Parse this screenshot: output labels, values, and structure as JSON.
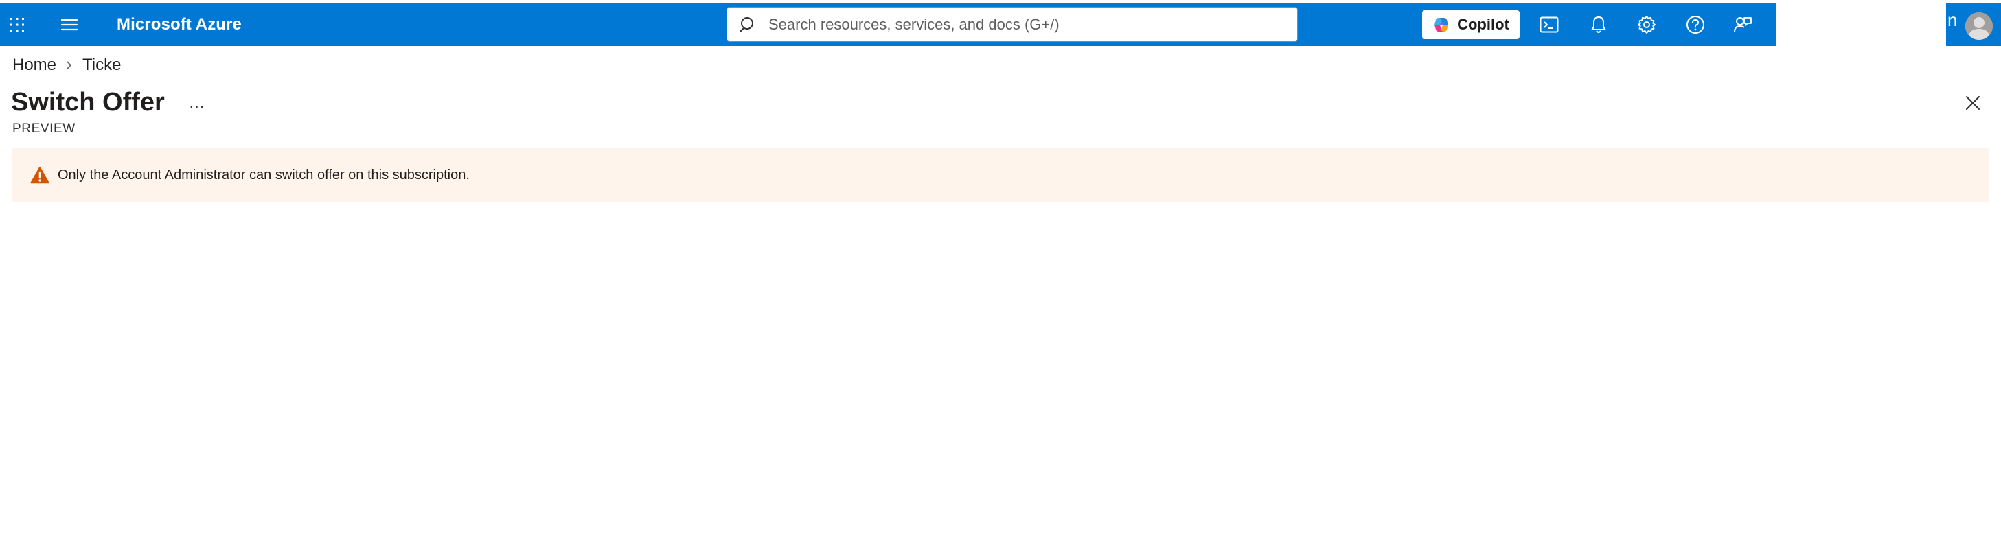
{
  "topbar": {
    "brand": "Microsoft Azure",
    "search_placeholder": "Search resources, services, and docs (G+/)",
    "copilot_label": "Copilot",
    "account_char": "n",
    "icons": [
      "waffle-icon",
      "hamburger-icon",
      "search-icon",
      "copilot-icon",
      "cloud-shell-icon",
      "bell-icon",
      "gear-icon",
      "help-icon",
      "feedback-icon",
      "avatar"
    ]
  },
  "breadcrumb": {
    "home": "Home",
    "second": "Ticke"
  },
  "page": {
    "title": "Switch Offer",
    "more": "...",
    "subtitle": "PREVIEW"
  },
  "banner": {
    "text": "Only the Account Administrator can switch offer on this subscription."
  },
  "colors": {
    "accent": "#0078d4",
    "warning_bg": "#fff4ec",
    "warning_icon": "#d35400"
  }
}
